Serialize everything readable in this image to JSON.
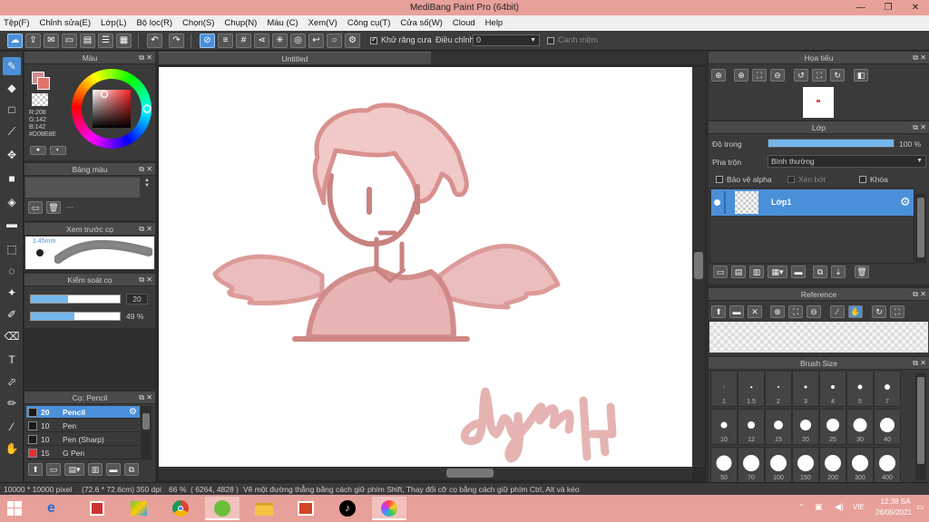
{
  "window": {
    "title": "MediBang Paint Pro (64bit)",
    "controls": [
      "—",
      "❐",
      "✕"
    ]
  },
  "menu": [
    "Tệp(F)",
    "Chỉnh sửa(E)",
    "Lớp(L)",
    "Bộ lọc(R)",
    "Chọn(S)",
    "Chụp(N)",
    "Màu (C)",
    "Xem(V)",
    "Công cụ(T)",
    "Cửa số(W)",
    "Cloud",
    "Help"
  ],
  "toolbar": {
    "antialias_label": "Khử răng cưa",
    "antialias_checked": true,
    "correction_label": "Điều chỉnh",
    "correction_value": "0",
    "smooth_label": "Canh mềm"
  },
  "color_panel": {
    "title": "Màu",
    "r": "R:208",
    "g": "G:142",
    "b": "B:142",
    "hex": "#D08E8E",
    "primary_color": "#d08e8e"
  },
  "palette_panel": {
    "title": "Bảng màu",
    "footer": "---"
  },
  "brush_preview": {
    "title": "Xem trước cọ",
    "size": "1.45mm"
  },
  "brush_control": {
    "title": "Kiểm soát cọ",
    "size_value": "20",
    "size_fill": 0.42,
    "opacity_value": "49 %",
    "opacity_fill": 0.49
  },
  "brush_list": {
    "title": "Cọ: Pencil",
    "items": [
      {
        "size": "20",
        "name": "Pencil",
        "color": "#1a1a1a",
        "selected": true
      },
      {
        "size": "10",
        "name": "Pen",
        "color": "#1a1a1a",
        "selected": false
      },
      {
        "size": "10",
        "name": "Pen (Sharp)",
        "color": "#1a1a1a",
        "selected": false
      },
      {
        "size": "15",
        "name": "G Pen",
        "color": "#e53030",
        "selected": false
      }
    ]
  },
  "canvas": {
    "tab_title": "Untitled"
  },
  "navigator": {
    "title": "Họa tiếu"
  },
  "layer_panel": {
    "title": "Lớp",
    "opacity_label": "Độ trong",
    "opacity_value": "100 %",
    "opacity_fill": 1.0,
    "blend_label": "Pha trộn",
    "blend_value": "Bình thường",
    "protect_alpha": "Bảo vệ alpha",
    "clipping": "Xén bớt",
    "lock": "Khóa",
    "layers": [
      {
        "name": "Lớp1",
        "visible": true
      }
    ]
  },
  "reference_panel": {
    "title": "Reference"
  },
  "brush_size_panel": {
    "title": "Brush Size",
    "sizes": [
      "1",
      "1.5",
      "2",
      "3",
      "4",
      "5",
      "7",
      "10",
      "12",
      "15",
      "20",
      "25",
      "30",
      "40",
      "50",
      "70",
      "100",
      "150",
      "200",
      "300",
      "400"
    ]
  },
  "status": {
    "dimensions": "10000 * 10000 pixel",
    "physical": "(72.6 * 72.6cm)",
    "dpi": "350 dpi",
    "zoom": "66 %",
    "coords": "( 6264, 4828 )",
    "hint": "Vẽ một đường thẳng bằng cách giữ phím Shift, Thay đổi cỡ cọ bằng cách giữ phím Ctrl, Alt và kéo"
  },
  "taskbar": {
    "time": "12:38 SA",
    "date": "26/05/2021",
    "lang": "VIE"
  },
  "colors": {
    "accent": "#4a90d9",
    "titlebar": "#e8a09a",
    "sketch": "#d9918f"
  }
}
